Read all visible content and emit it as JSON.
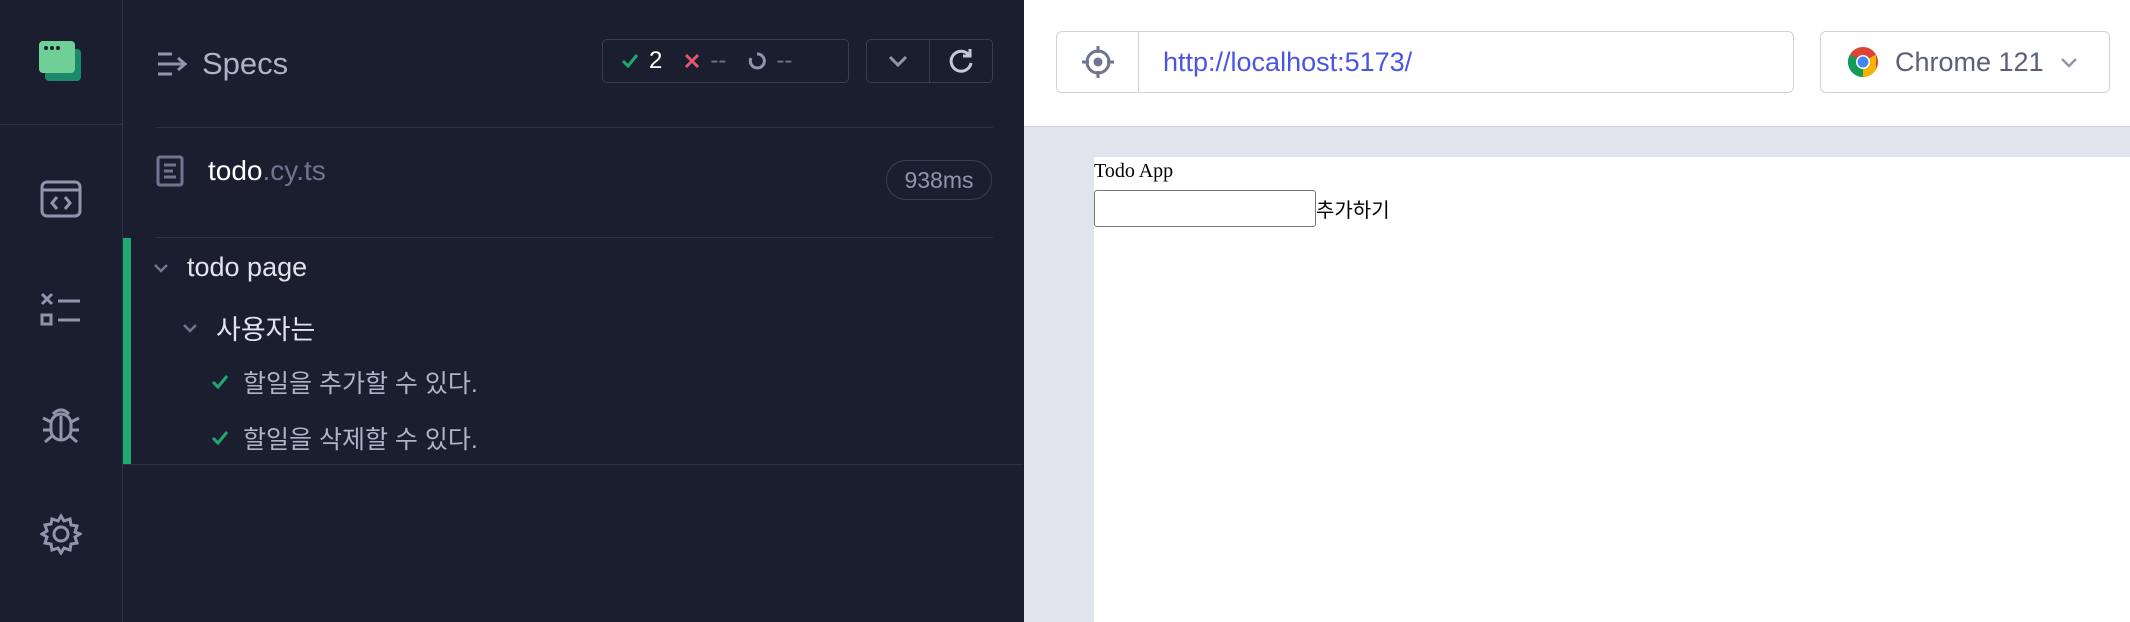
{
  "nav": {
    "items": [
      {
        "name": "specs-nav",
        "icon": "code-window-icon"
      },
      {
        "name": "runs-nav",
        "icon": "checklist-icon"
      },
      {
        "name": "debug-nav",
        "icon": "bug-icon"
      },
      {
        "name": "settings-nav",
        "icon": "gear-icon"
      }
    ]
  },
  "reporter": {
    "title": "Specs",
    "stats": {
      "passed": "2",
      "failed": "--",
      "pending": "--"
    },
    "file": {
      "name": "todo",
      "ext": ".cy.ts",
      "duration": "938ms"
    },
    "suite": "todo page",
    "subsuite": "사용자는",
    "tests": [
      {
        "label": "할일을 추가할 수 있다.",
        "state": "passed"
      },
      {
        "label": "할일을 삭제할 수 있다.",
        "state": "passed"
      }
    ]
  },
  "browser": {
    "url": "http://localhost:5173/",
    "name": "Chrome 121"
  },
  "app": {
    "title": "Todo App",
    "input_value": "",
    "add_label": "추가하기"
  },
  "colors": {
    "pass": "#1fa971",
    "fail": "#e45770",
    "accent": "#4956e3",
    "background": "#1b1e2e"
  }
}
